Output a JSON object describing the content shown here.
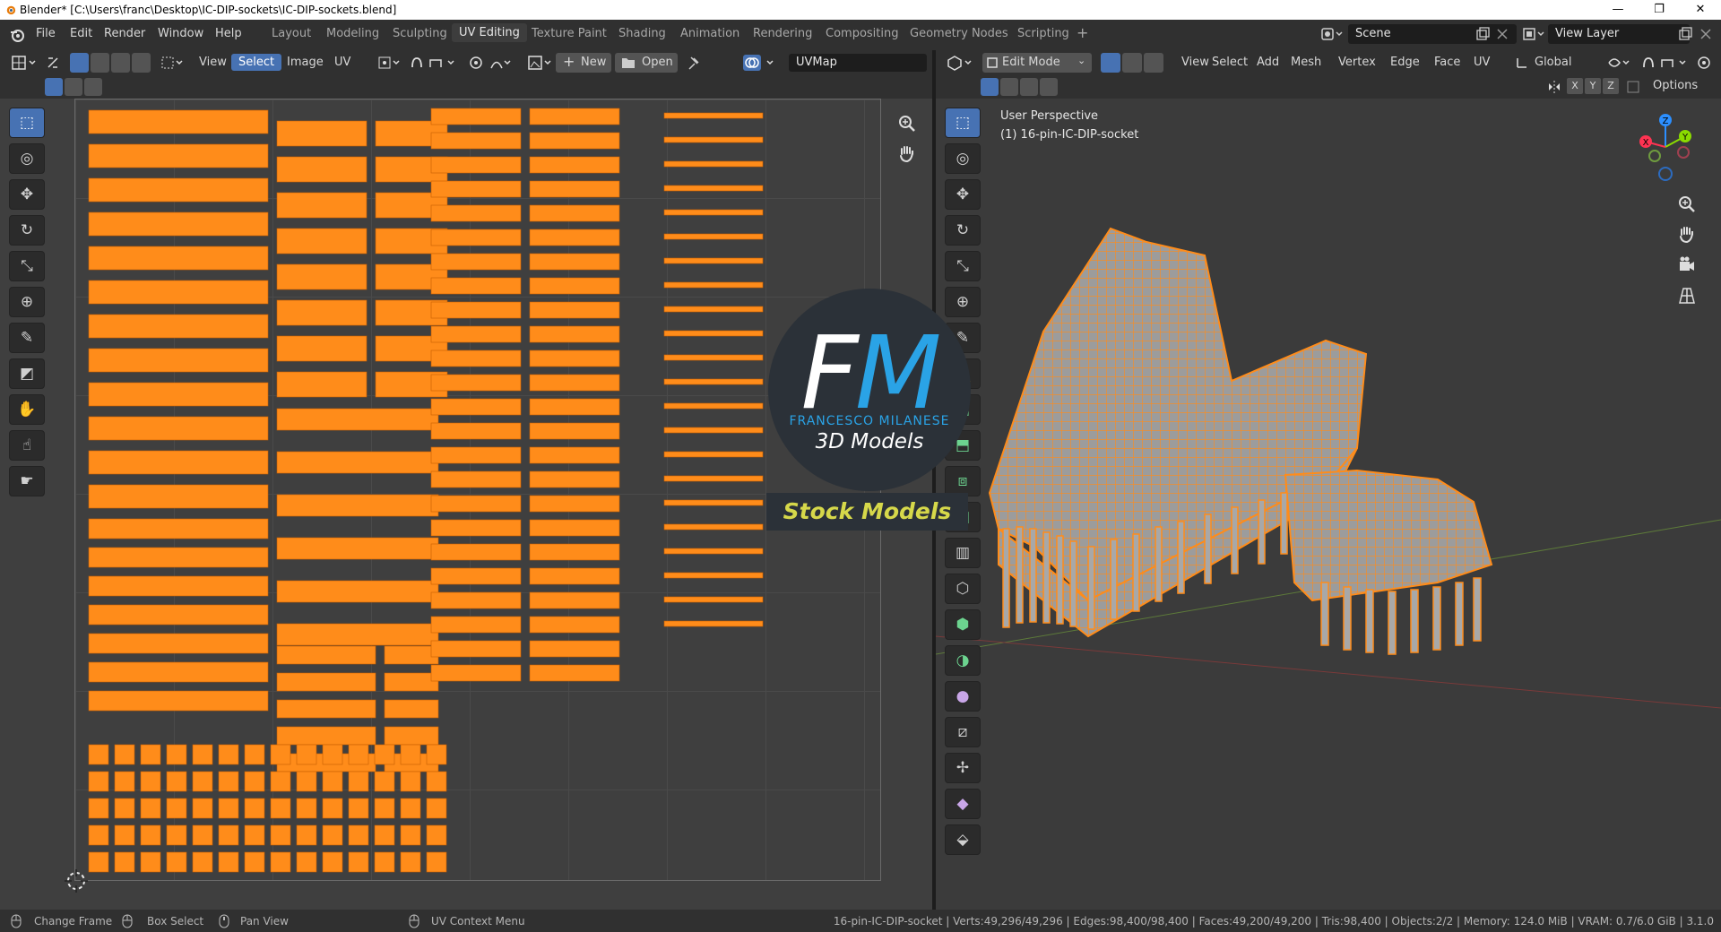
{
  "window": {
    "title": "Blender* [C:\\Users\\franc\\Desktop\\IC-DIP-sockets\\IC-DIP-sockets.blend]",
    "minimize": "—",
    "maximize": "❐",
    "close": "✕"
  },
  "menu": {
    "file": "File",
    "edit": "Edit",
    "render": "Render",
    "window": "Window",
    "help": "Help"
  },
  "workspaces": [
    "Layout",
    "Modeling",
    "Sculpting",
    "UV Editing",
    "Texture Paint",
    "Shading",
    "Animation",
    "Rendering",
    "Compositing",
    "Geometry Nodes",
    "Scripting"
  ],
  "workspace_add": "+",
  "scene": {
    "name": "Scene",
    "view_layer": "View Layer"
  },
  "uv_editor": {
    "menus": {
      "view": "View",
      "select": "Select",
      "image": "Image",
      "uv": "UV"
    },
    "new_label": "New",
    "open_label": "Open",
    "uvmap": "UVMap"
  },
  "viewport": {
    "mode": "Edit Mode",
    "menus": {
      "view": "View",
      "select": "Select",
      "add": "Add",
      "mesh": "Mesh",
      "vertex": "Vertex",
      "edge": "Edge",
      "face": "Face",
      "uv": "UV"
    },
    "orientation": "Global",
    "axes": {
      "x": "X",
      "y": "Y",
      "z": "Z"
    },
    "options": "Options",
    "perspective": "User Perspective",
    "object": "(1) 16-pin-IC-DIP-socket",
    "gizmo": {
      "x": "X",
      "y": "Y",
      "z": "Z"
    }
  },
  "watermark": {
    "fm_white": "F",
    "fm_blue": "M",
    "name": "FRANCESCO MILANESE",
    "subtitle": "3D Models",
    "badge": "Stock Models"
  },
  "status": {
    "change_frame": "Change Frame",
    "box_select": "Box Select",
    "pan_view": "Pan View",
    "context_menu": "UV Context Menu",
    "stats": "16-pin-IC-DIP-socket | Verts:49,296/49,296 | Edges:98,400/98,400 | Faces:49,200/49,200 | Tris:98,400 | Objects:2/2 | Memory: 124.0 MiB | VRAM: 0.7/6.0 GiB | 3.1.0"
  },
  "colors": {
    "accent": "#4772b3",
    "uv_orange": "#ff8c1a",
    "logo_blue": "#2aa3e6",
    "badge_text": "#d6d84a"
  }
}
